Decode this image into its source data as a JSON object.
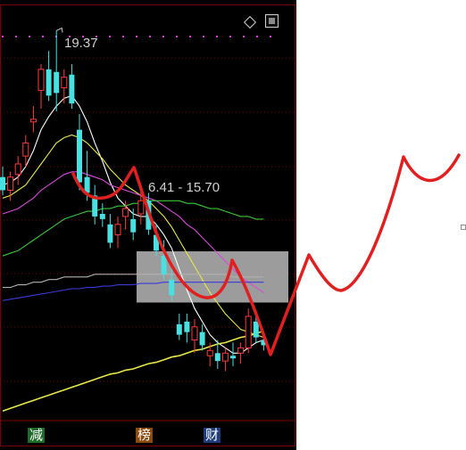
{
  "chart_data": {
    "type": "candlestick",
    "annotations": {
      "peak_label": "19.37",
      "range_label": "6.41 - 15.70"
    },
    "legend_tags": [
      "减",
      "榜",
      "财"
    ],
    "candles": [
      {
        "o": 13.8,
        "h": 14.2,
        "l": 13.1,
        "c": 13.3
      },
      {
        "o": 13.3,
        "h": 14.0,
        "l": 12.9,
        "c": 13.8
      },
      {
        "o": 13.9,
        "h": 14.6,
        "l": 13.5,
        "c": 14.3
      },
      {
        "o": 14.6,
        "h": 15.4,
        "l": 14.2,
        "c": 15.1
      },
      {
        "o": 15.9,
        "h": 16.5,
        "l": 15.5,
        "c": 16.0
      },
      {
        "o": 17.1,
        "h": 18.1,
        "l": 16.4,
        "c": 17.9
      },
      {
        "o": 17.9,
        "h": 18.6,
        "l": 16.7,
        "c": 16.9
      },
      {
        "o": 17.8,
        "h": 19.37,
        "l": 16.3,
        "c": 17.0
      },
      {
        "o": 17.2,
        "h": 17.9,
        "l": 16.6,
        "c": 17.6
      },
      {
        "o": 17.7,
        "h": 18.1,
        "l": 16.4,
        "c": 16.6
      },
      {
        "o": 15.6,
        "h": 16.2,
        "l": 13.3,
        "c": 13.6
      },
      {
        "o": 13.8,
        "h": 14.8,
        "l": 12.9,
        "c": 13.2
      },
      {
        "o": 13.1,
        "h": 13.5,
        "l": 12.0,
        "c": 12.3
      },
      {
        "o": 12.4,
        "h": 12.8,
        "l": 11.9,
        "c": 12.2
      },
      {
        "o": 12.0,
        "h": 12.4,
        "l": 11.1,
        "c": 11.3
      },
      {
        "o": 11.6,
        "h": 12.3,
        "l": 11.1,
        "c": 12.0
      },
      {
        "o": 12.3,
        "h": 12.9,
        "l": 11.8,
        "c": 12.6
      },
      {
        "o": 12.2,
        "h": 12.6,
        "l": 11.4,
        "c": 11.7
      },
      {
        "o": 12.4,
        "h": 13.4,
        "l": 12.0,
        "c": 12.9
      },
      {
        "o": 12.9,
        "h": 13.2,
        "l": 11.6,
        "c": 11.8
      },
      {
        "o": 11.6,
        "h": 12.0,
        "l": 10.8,
        "c": 11.0
      },
      {
        "o": 10.8,
        "h": 11.4,
        "l": 9.9,
        "c": 10.1
      },
      {
        "o": 9.9,
        "h": 10.4,
        "l": 9.1,
        "c": 9.3
      },
      {
        "o": 8.2,
        "h": 8.6,
        "l": 7.6,
        "c": 7.8
      },
      {
        "o": 8.3,
        "h": 8.6,
        "l": 7.5,
        "c": 7.9
      },
      {
        "o": 7.6,
        "h": 8.4,
        "l": 7.1,
        "c": 8.1
      },
      {
        "o": 7.9,
        "h": 8.2,
        "l": 7.2,
        "c": 7.4
      },
      {
        "o": 7.0,
        "h": 7.5,
        "l": 6.6,
        "c": 7.2
      },
      {
        "o": 7.1,
        "h": 7.6,
        "l": 6.5,
        "c": 6.8
      },
      {
        "o": 6.8,
        "h": 7.3,
        "l": 6.41,
        "c": 7.1
      },
      {
        "o": 7.0,
        "h": 7.5,
        "l": 6.6,
        "c": 6.9
      },
      {
        "o": 7.1,
        "h": 7.5,
        "l": 6.7,
        "c": 7.3
      },
      {
        "o": 7.3,
        "h": 8.8,
        "l": 7.1,
        "c": 8.5
      },
      {
        "o": 8.3,
        "h": 8.6,
        "l": 7.5,
        "c": 7.7
      },
      {
        "o": 7.6,
        "h": 7.8,
        "l": 7.2,
        "c": 7.4
      }
    ],
    "ylim": [
      4.6,
      20.2
    ],
    "highlight_range": [
      9.5,
      10.5
    ],
    "ma_series": [
      {
        "color": "#ffffff",
        "values": [
          13.5,
          13.6,
          13.8,
          14.2,
          14.8,
          15.6,
          16.1,
          16.5,
          16.8,
          16.9,
          16.5,
          15.9,
          15.1,
          14.4,
          13.6,
          13.0,
          12.7,
          12.4,
          12.3,
          12.3,
          12.0,
          11.6,
          11.1,
          10.3,
          9.5,
          8.8,
          8.3,
          7.8,
          7.5,
          7.3,
          7.1,
          7.1,
          7.3,
          7.5,
          7.6
        ]
      },
      {
        "color": "#e8e84a",
        "values": [
          13.0,
          13.1,
          13.3,
          13.5,
          13.9,
          14.3,
          14.7,
          15.1,
          15.3,
          15.4,
          15.3,
          15.1,
          14.8,
          14.5,
          14.1,
          13.8,
          13.5,
          13.3,
          13.1,
          12.9,
          12.6,
          12.3,
          11.9,
          11.4,
          10.9,
          10.4,
          9.9,
          9.4,
          9.0,
          8.6,
          8.3,
          8.0,
          7.9,
          7.8,
          7.7
        ]
      },
      {
        "color": "#d84ad8",
        "values": [
          12.4,
          12.5,
          12.6,
          12.8,
          13.0,
          13.3,
          13.5,
          13.7,
          13.9,
          14.0,
          14.0,
          13.9,
          13.8,
          13.7,
          13.5,
          13.4,
          13.3,
          13.2,
          13.1,
          13.0,
          12.9,
          12.7,
          12.5,
          12.3,
          12.0,
          11.8,
          11.5,
          11.2,
          10.9,
          10.6,
          10.3,
          10.0,
          9.8,
          9.6,
          9.4
        ]
      },
      {
        "color": "#3ac83a",
        "values": [
          10.8,
          10.9,
          11.0,
          11.2,
          11.4,
          11.6,
          11.8,
          12.0,
          12.2,
          12.3,
          12.4,
          12.5,
          12.5,
          12.6,
          12.6,
          12.7,
          12.7,
          12.8,
          12.8,
          12.9,
          12.9,
          12.9,
          12.9,
          12.9,
          12.8,
          12.8,
          12.7,
          12.6,
          12.6,
          12.5,
          12.4,
          12.3,
          12.3,
          12.2,
          12.2
        ]
      },
      {
        "color": "#b0b0b0",
        "values": [
          9.6,
          9.6,
          9.7,
          9.7,
          9.8,
          9.8,
          9.9,
          9.9,
          10.0,
          10.0,
          10.0,
          10.0,
          10.1,
          10.1,
          10.1,
          10.1,
          10.1,
          10.1,
          10.1,
          10.1,
          10.1,
          10.1,
          10.1,
          10.1,
          10.1,
          10.1,
          10.1,
          10.1,
          10.1,
          10.1,
          10.0,
          10.0,
          10.0,
          10.0,
          10.0
        ]
      },
      {
        "color": "#3a3ad8",
        "values": [
          9.1,
          9.15,
          9.2,
          9.25,
          9.3,
          9.35,
          9.4,
          9.45,
          9.5,
          9.55,
          9.55,
          9.6,
          9.6,
          9.65,
          9.65,
          9.7,
          9.7,
          9.7,
          9.75,
          9.75,
          9.75,
          9.8,
          9.8,
          9.8,
          9.8,
          9.8,
          9.8,
          9.8,
          9.8,
          9.8,
          9.8,
          9.8,
          9.8,
          9.8,
          9.8
        ]
      },
      {
        "color": "#e8e84a",
        "values": [
          4.9,
          5.0,
          5.1,
          5.2,
          5.3,
          5.4,
          5.5,
          5.6,
          5.7,
          5.8,
          5.9,
          6.0,
          6.1,
          6.2,
          6.3,
          6.35,
          6.45,
          6.5,
          6.6,
          6.7,
          6.75,
          6.85,
          6.95,
          7.0,
          7.1,
          7.2,
          7.25,
          7.35,
          7.45,
          7.5,
          7.6,
          7.7,
          7.75,
          7.85,
          7.95
        ]
      }
    ],
    "colors": {
      "up": "#ff3a3a",
      "down": "#48e0e0",
      "grid": "#7a0000",
      "dots": "#d83ad8",
      "drawing": "#e02020",
      "highlight": "#c8c8c8"
    }
  }
}
